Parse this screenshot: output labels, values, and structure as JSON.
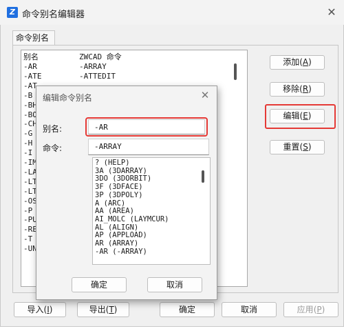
{
  "window": {
    "title": "命令别名编辑器",
    "app_icon_glyph": "Z",
    "close_glyph": "✕"
  },
  "tab": {
    "label": "命令别名"
  },
  "list": {
    "headers": [
      "别名",
      "ZWCAD 命令"
    ],
    "rows": [
      [
        "-AR",
        "-ARRAY"
      ],
      [
        "-ATE",
        "-ATTEDIT"
      ],
      [
        "-AT",
        ""
      ],
      [
        "-B",
        ""
      ],
      [
        "-BH",
        ""
      ],
      [
        "-BO",
        ""
      ],
      [
        "-CH",
        ""
      ],
      [
        "-G",
        ""
      ],
      [
        "-H",
        ""
      ],
      [
        "-I",
        ""
      ],
      [
        "-IM",
        ""
      ],
      [
        "-LA",
        ""
      ],
      [
        "-LT",
        ""
      ],
      [
        "-LT",
        ""
      ],
      [
        "-OS",
        ""
      ],
      [
        "-P",
        ""
      ],
      [
        "-PU",
        ""
      ],
      [
        "-RE",
        ""
      ],
      [
        "-T",
        ""
      ],
      [
        "-UN",
        ""
      ]
    ]
  },
  "side_buttons": {
    "add": {
      "label": "添加",
      "key": "A"
    },
    "remove": {
      "label": "移除",
      "key": "R"
    },
    "edit": {
      "label": "编辑",
      "key": "E"
    },
    "reset": {
      "label": "重置",
      "key": "S"
    }
  },
  "bottom_buttons": {
    "import": {
      "label": "导入",
      "key": "I"
    },
    "export": {
      "label": "导出",
      "key": "T"
    },
    "ok": "确定",
    "cancel": "取消",
    "apply": {
      "label": "应用",
      "key": "P"
    }
  },
  "dialog": {
    "title": "编辑命令别名",
    "close_glyph": "✕",
    "alias_label": "别名:",
    "alias_value": "-AR",
    "command_label": "命令:",
    "command_value": "-ARRAY",
    "commands": [
      "? (HELP)",
      "3A (3DARRAY)",
      "3DO (3DORBIT)",
      "3F (3DFACE)",
      "3P (3DPOLY)",
      "A (ARC)",
      "AA (AREA)",
      "AI_MOLC (LAYMCUR)",
      "AL (ALIGN)",
      "AP (APPLOAD)",
      "AR (ARRAY)",
      "-AR (-ARRAY)"
    ],
    "ok": "确定",
    "cancel": "取消"
  },
  "colors": {
    "highlight": "#e53935",
    "app_icon": "#1f6fe0"
  }
}
